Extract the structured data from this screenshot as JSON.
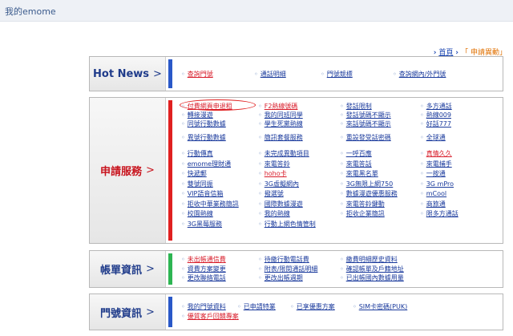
{
  "header": {
    "title": "我的emome"
  },
  "breadcrumb": {
    "home": "首頁",
    "separator": "「",
    "current": "申請異動」"
  },
  "colors": {
    "hot": "#1f3b8a",
    "apply": "#c8141e",
    "bill": "#1f3b8a",
    "number": "#1f3b8a",
    "accent_red": "#e02020",
    "stripe_green": "#2db552",
    "stripe_blue": "#2a58c8"
  },
  "hot_news": {
    "label": "Hot News",
    "items": [
      "查詢門號",
      "通話明細",
      "門號競標",
      "查詢網內/外門號"
    ]
  },
  "apply": {
    "label": "申請服務",
    "groups": [
      [
        "付費網頁申退租",
        "F2熱線號碼",
        "發話限制",
        "多方通話",
        "轉接漫遊",
        "我的同班同學",
        "發話號碼不顯示",
        "熱線009",
        "同號行動數據",
        "學生死黨熱線",
        "來話號碼不顯示",
        "好話777"
      ],
      [
        "異號行動數據",
        "簡訊套餐服務",
        "重設發受話密碼",
        "全球通"
      ],
      [
        "行動傳真",
        "未完成異動項目",
        "一呼百應",
        "真情久久",
        "emome理財通",
        "來電答鈴",
        "來電答話",
        "來電捕手",
        "快遞郵",
        "hoho卡",
        "來電黑名單",
        "一按通",
        "雙號同振",
        "3G虛擬網內",
        "3G無限上網750",
        "3G mPro",
        "VIP語音信箱",
        "撥選號",
        "數據漫遊優惠服務",
        "mCool",
        "拒收中華業務簡訊",
        "國際數據漫遊",
        "來電答鈴鍵動",
        "商旅通",
        "校園熱線",
        "我的熱線",
        "拒收企業簡訊",
        "限多方通話",
        "3G黑莓服務",
        "行動上網色情管制"
      ]
    ]
  },
  "bill": {
    "label": "帳單資訊",
    "items": [
      "未出帳通信費",
      "待繳行動電話費",
      "繳費明細歷史資料",
      "資費方案變更",
      "附表/限閱通話明細",
      "確認帳單及戶籍地址",
      "更改聯絡電話",
      "更改出帳週期",
      "已出帳國內數據用量"
    ]
  },
  "number": {
    "label": "門號資訊",
    "items": [
      "我的門號資料",
      "已申請特業",
      "已享優惠方案",
      "SIM卡密碼(PUK)",
      "優質客戶回饋專案"
    ]
  }
}
